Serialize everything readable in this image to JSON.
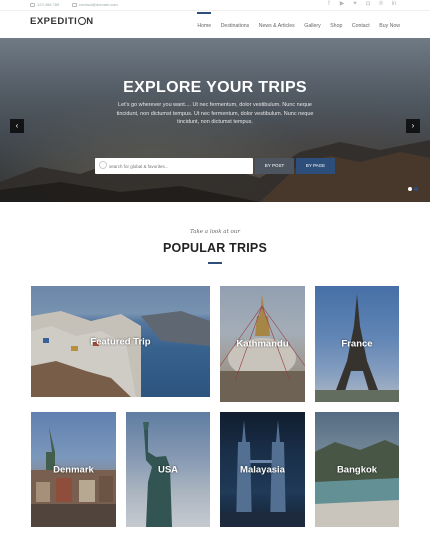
{
  "topbar": {
    "phone": "123 456 789",
    "email": "contact@domain.com",
    "social_icons": [
      "facebook-icon",
      "youtube-icon",
      "twitter-icon",
      "instagram-icon",
      "pinterest-icon",
      "linkedin-icon"
    ]
  },
  "nav": {
    "logo": "EXPEDITI",
    "logo_end": "N",
    "items": [
      "Home",
      "Destinations",
      "News & Articles",
      "Gallery",
      "Shop",
      "Contact",
      "Buy Now"
    ],
    "active_item": "Home"
  },
  "hero": {
    "title": "EXPLORE YOUR TRIPS",
    "description": "Let's go wherever you want.... Ut nec fermentum, dolor vestibulum. Nunc neque tincidunt, non dictumst tempus. Ut nec fermentum, dolor vestibulum. Nunc neque tincidunt, non dictumst tempus.",
    "search_placeholder": "search for global & favorites...",
    "btn_post": "BY POST",
    "btn_page": "BY PAGE",
    "prev_arrow": "‹",
    "next_arrow": "›"
  },
  "section": {
    "tagline": "Take a look at our",
    "title": "POPULAR TRIPS"
  },
  "trips": [
    "Featured Trip",
    "Kathmandu",
    "France",
    "Denmark",
    "USA",
    "Malayasia",
    "Bangkok"
  ],
  "colors": {
    "accent": "#2d4e7a",
    "dark_button": "#4d5560"
  }
}
